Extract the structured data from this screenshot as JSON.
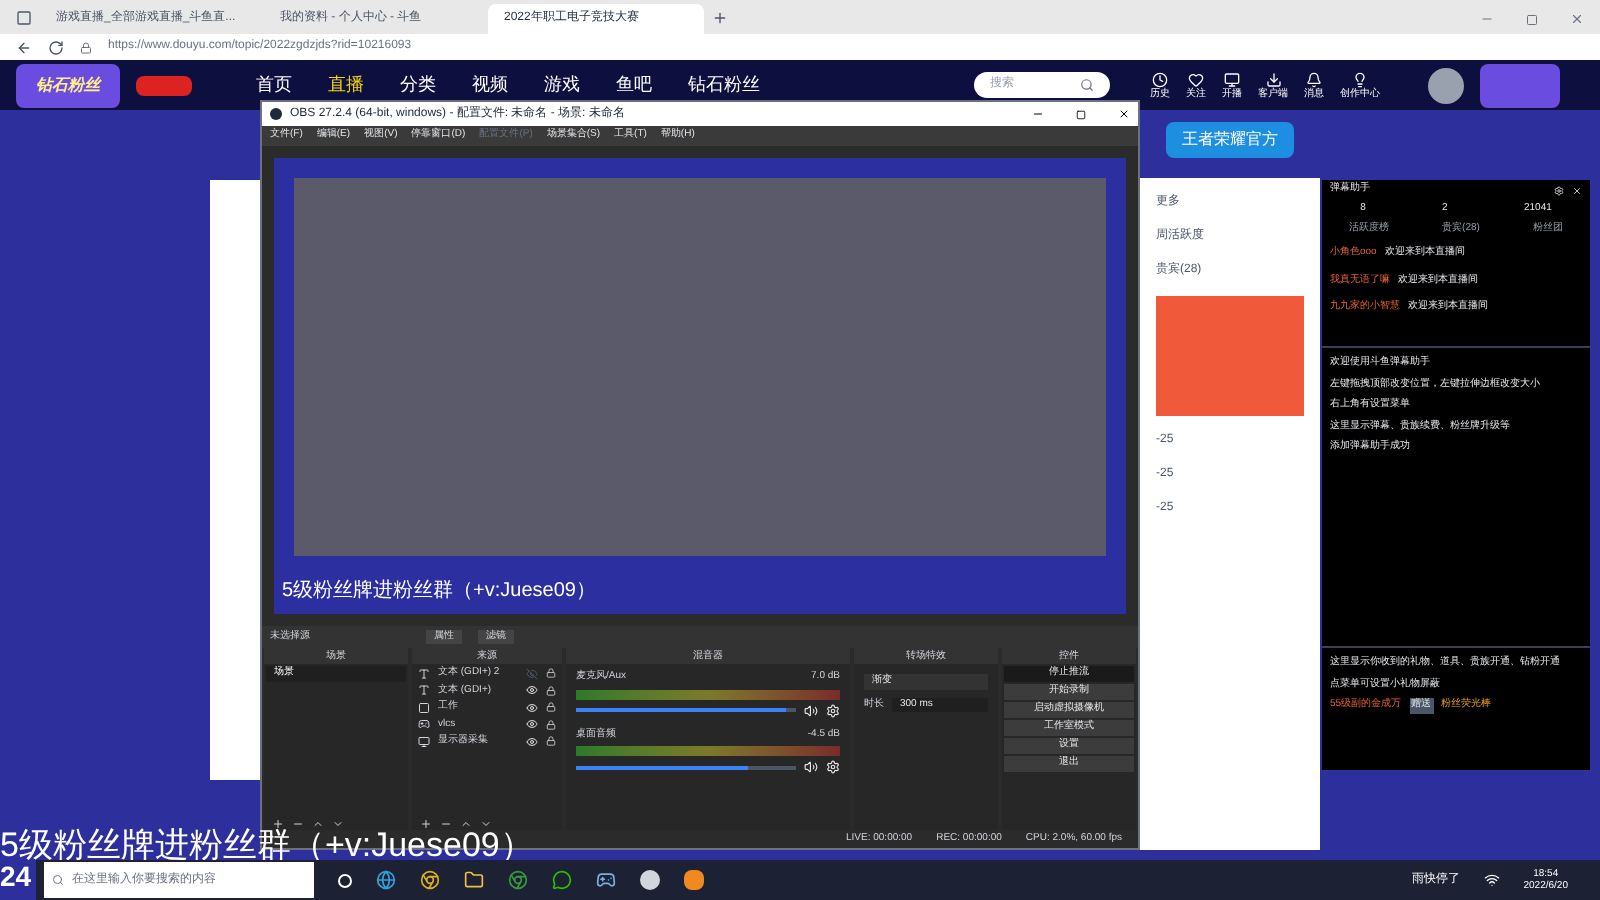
{
  "browser": {
    "tabs": [
      {
        "title": "游戏直播_全部游戏直播_斗鱼直...",
        "selected": false
      },
      {
        "title": "我的资料 - 个人中心 - 斗鱼",
        "selected": false
      },
      {
        "title": "2022年职工电子竞技大赛",
        "selected": true
      }
    ],
    "address": "https://www.douyu.com/topic/2022zgdzjds?rid=10216093"
  },
  "site_nav": {
    "logo_badge": "钻石粉丝",
    "items": [
      {
        "label": "首页",
        "selected": false
      },
      {
        "label": "直播",
        "selected": true
      },
      {
        "label": "分类",
        "selected": false
      },
      {
        "label": "视频",
        "selected": false
      },
      {
        "label": "游戏",
        "selected": false
      },
      {
        "label": "鱼吧",
        "selected": false
      },
      {
        "label": "钻石粉丝",
        "selected": false
      }
    ],
    "search": {
      "placeholder": "搜索"
    },
    "tools": [
      "历史",
      "关注",
      "开播",
      "客户端",
      "消息",
      "创作中心"
    ],
    "banner": "王者荣耀官方"
  },
  "side_content": {
    "items": [
      "更多",
      "周活跃度",
      "贵宾(28)"
    ],
    "scores": [
      "-25",
      "-25",
      "-25"
    ]
  },
  "obs": {
    "title": "OBS 27.2.4 (64-bit, windows) - 配置文件: 未命名 - 场景: 未命名",
    "menu": [
      {
        "label": "文件(F)",
        "disabled": false
      },
      {
        "label": "编辑(E)",
        "disabled": false
      },
      {
        "label": "视图(V)",
        "disabled": false
      },
      {
        "label": "停靠窗口(D)",
        "disabled": false
      },
      {
        "label": "配置文件(P)",
        "disabled": true
      },
      {
        "label": "场景集合(S)",
        "disabled": false
      },
      {
        "label": "工具(T)",
        "disabled": false
      },
      {
        "label": "帮助(H)",
        "disabled": false
      }
    ],
    "preview_caption": "5级粉丝牌进粉丝群（+v:Juese09）",
    "source_bar": {
      "label": "未选择源",
      "buttons": [
        "属性",
        "滤镜"
      ]
    },
    "docks": [
      "场景",
      "来源",
      "混音器",
      "转场特效",
      "控件"
    ],
    "scenes": [
      {
        "name": "场景",
        "selected": true
      }
    ],
    "sources": [
      {
        "name": "文本 (GDI+) 2",
        "kind": "text",
        "visible": false
      },
      {
        "name": "文本 (GDI+)",
        "kind": "text",
        "visible": true
      },
      {
        "name": "工作",
        "kind": "window",
        "visible": true
      },
      {
        "name": "vlcs",
        "kind": "media",
        "visible": true
      },
      {
        "name": "显示器采集",
        "kind": "display",
        "visible": true
      }
    ],
    "mixer": [
      {
        "name": "麦克风/Aux",
        "reading": "7.0 dB",
        "level": 0.95
      },
      {
        "name": "桌面音频",
        "reading": "-4.5 dB",
        "level": 0.78
      }
    ],
    "transition": {
      "value": "渐变",
      "duration_label": "时长",
      "duration": "300 ms"
    },
    "controls": [
      {
        "label": "停止推流",
        "active": true
      },
      {
        "label": "开始录制",
        "active": false
      },
      {
        "label": "启动虚拟摄像机",
        "active": false
      },
      {
        "label": "工作室模式",
        "active": false
      },
      {
        "label": "设置",
        "active": false
      },
      {
        "label": "退出",
        "active": false
      }
    ],
    "status": [
      "LIVE: 00:00:00",
      "REC: 00:00:00",
      "CPU: 2.0%, 60.00 fps"
    ]
  },
  "danmu": {
    "title": "弹幕助手",
    "stats": [
      "8",
      "2",
      "21041"
    ],
    "tabs": [
      "活跃度榜",
      "贵宾(28)",
      "粉丝团"
    ],
    "messages": [
      {
        "user": "小角色ooo",
        "text": "欢迎来到本直播间"
      },
      {
        "user": "我真无语了嘛",
        "text": "欢迎来到本直播间"
      },
      {
        "user": "九九家的小智慧",
        "text": "欢迎来到本直播间"
      }
    ],
    "notices": [
      "欢迎使用斗鱼弹幕助手",
      "左键拖拽顶部改变位置，左键拉伸边框改变大小",
      "右上角有设置菜单",
      "这里显示弹幕、贵族续费、粉丝牌升级等",
      "添加弹幕助手成功"
    ],
    "gift_notices": [
      "这里显示你收到的礼物、道具、贵族开通、钻粉开通",
      "点菜单可设置小礼物屏蔽"
    ],
    "gift_user": "55级副的金成万",
    "gift_tag": "赠送",
    "gift_name": "粉丝荧光棒"
  },
  "caption": "5级粉丝牌进粉丝群（+v:Juese09）",
  "corner_number": "24",
  "taskbar": {
    "search": {
      "placeholder": "在这里输入你要搜索的内容"
    },
    "weather": "雨快停了",
    "time": "18:54",
    "date": "2022/6/20"
  }
}
